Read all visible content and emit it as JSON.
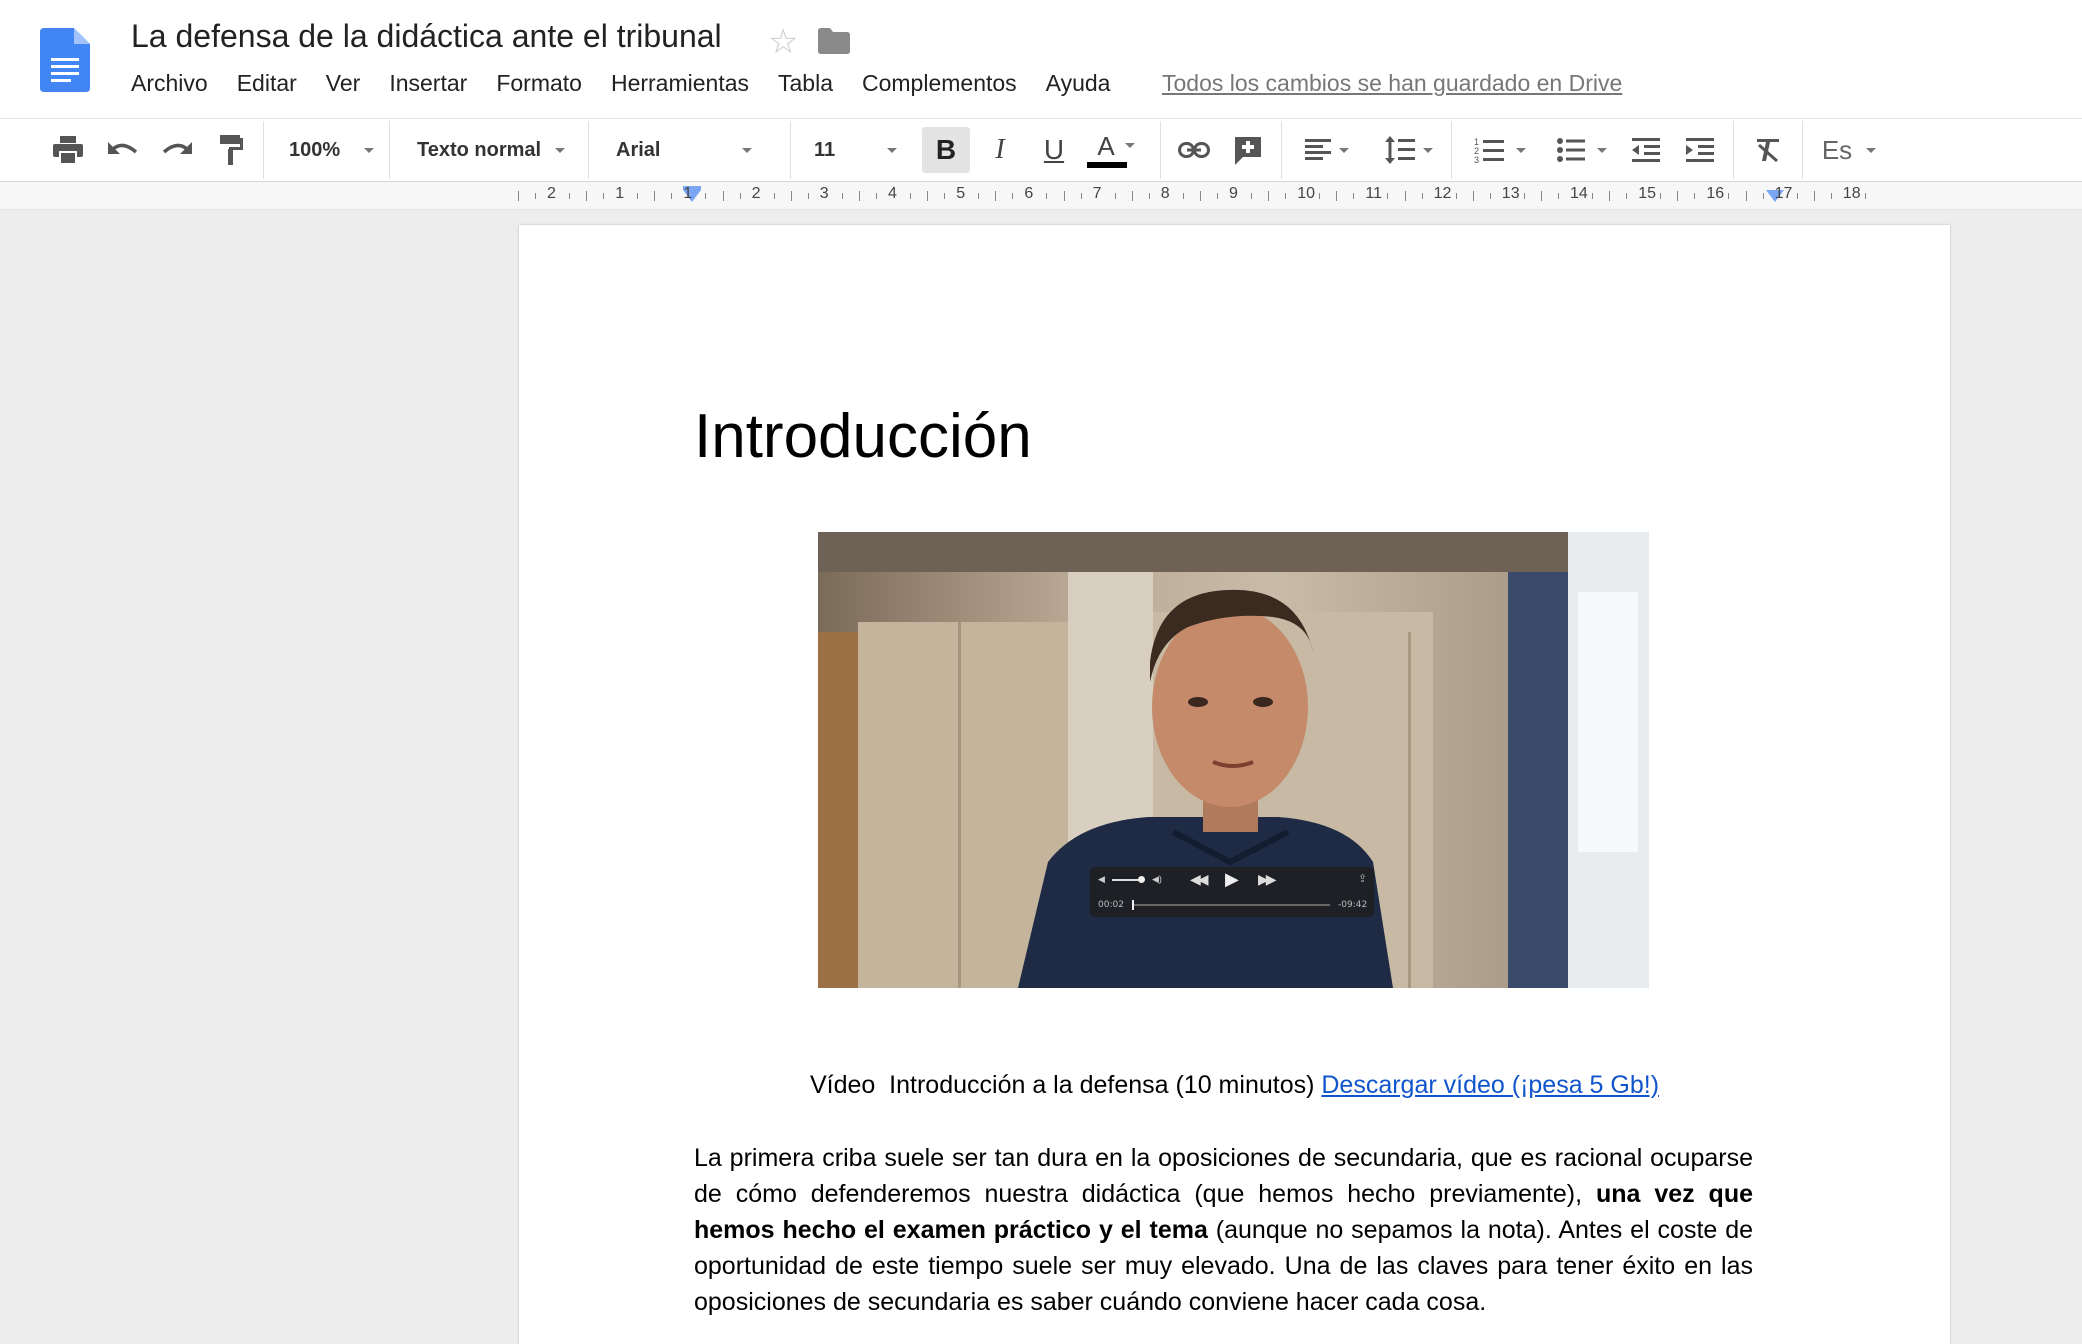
{
  "app": {
    "doc_title": "La defensa de la didáctica ante el tribunal",
    "save_status": "Todos los cambios se han guardado en Drive"
  },
  "menu": [
    "Archivo",
    "Editar",
    "Ver",
    "Insertar",
    "Formato",
    "Herramientas",
    "Tabla",
    "Complementos",
    "Ayuda"
  ],
  "toolbar": {
    "zoom": "100%",
    "style": "Texto normal",
    "font": "Arial",
    "font_size": "11",
    "bold": "B",
    "italic": "I",
    "underline": "U",
    "text_color": "A",
    "input_tool": "Es"
  },
  "ruler": {
    "labels": [
      "2",
      "1",
      "1",
      "2",
      "3",
      "4",
      "5",
      "6",
      "7",
      "8",
      "9",
      "10",
      "11",
      "12",
      "13",
      "14",
      "15",
      "16",
      "17",
      "18"
    ]
  },
  "document": {
    "heading": "Introducción",
    "video": {
      "current_time": "00:02",
      "remaining_time": "-09:42"
    },
    "caption_text": "Vídeo  Introducción a la defensa (10 minutos)",
    "caption_link": "Descargar vídeo (¡pesa 5 Gb!)",
    "paragraph": {
      "part1": "La primera criba suele ser tan dura en la oposiciones de secundaria, que es racional ocuparse de cómo defenderemos nuestra didáctica (que hemos hecho previamente), ",
      "bold": "una vez que hemos hecho el examen práctico y el tema",
      "part2": " (aunque no sepamos la nota). Antes el coste de oportunidad de este tiempo suele ser muy elevado. Una de las claves para tener éxito en las oposiciones de secundaria es saber cuándo conviene hacer cada cosa."
    }
  },
  "colors": {
    "docs_blue": "#4285f4",
    "link": "#1155cc",
    "text_color_bar": "#000000"
  }
}
